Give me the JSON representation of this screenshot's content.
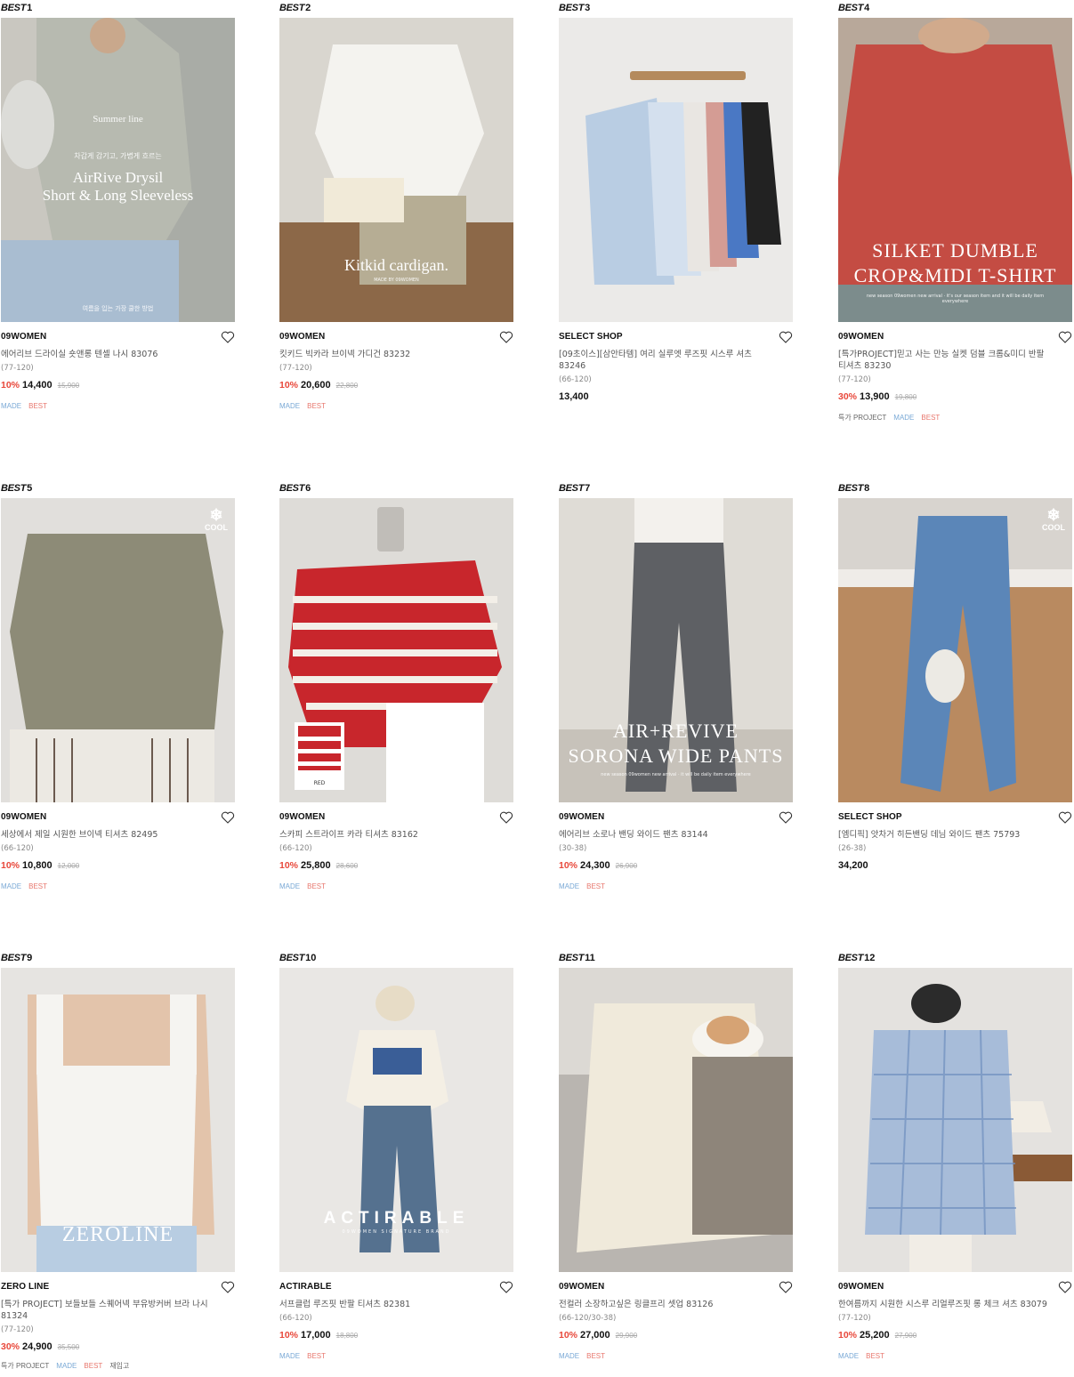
{
  "best_label": "BEST",
  "colors": {
    "discount": "#e8473a",
    "made_tag": "#7aa9d6",
    "best_tag": "#e8776d"
  },
  "products": [
    {
      "rank": "1",
      "brand": "09WOMEN",
      "name": "에어리브 드라이실 숏앤롱 텐셀 나시 83076",
      "size": "(77-120)",
      "discount": "10%",
      "price": "14,400",
      "original": "15,900",
      "tags": [
        "MADE",
        "BEST"
      ],
      "image": {
        "overlay_small": "Summer line",
        "overlay_sub": "차갑게 감기고, 가볍게 흐르는",
        "overlay_title_1": "AirRive Drysil",
        "overlay_title_2": "Short & Long Sleeveless",
        "overlay_caption": "여름을 입는 가장 쿨한 방법"
      }
    },
    {
      "rank": "2",
      "brand": "09WOMEN",
      "name": "킷키드 빅카라 브이넥 가디건 83232",
      "size": "(77-120)",
      "discount": "10%",
      "price": "20,600",
      "original": "22,800",
      "tags": [
        "MADE",
        "BEST"
      ],
      "image": {
        "overlay_title_1": "Kitkid cardigan.",
        "overlay_caption": "MADE BY 09WOMEN"
      }
    },
    {
      "rank": "3",
      "brand": "SELECT SHOP",
      "name": "[09초이스][삼안타템] 여리 실루엣 루즈핏 시스루 셔츠 83246",
      "size": "(66-120)",
      "discount": "",
      "price": "13,400",
      "original": "",
      "tags": [],
      "image": {}
    },
    {
      "rank": "4",
      "brand": "09WOMEN",
      "name": "[특가PROJECT]믿고 사는 만능 실켓 덤블 크롭&미디 반팔 티셔츠 83230",
      "size": "(77-120)",
      "discount": "30%",
      "price": "13,900",
      "original": "19,800",
      "tags": [
        "특가 PROJECT",
        "MADE",
        "BEST"
      ],
      "image": {
        "overlay_title_1": "SILKET DUMBLE",
        "overlay_title_2": "CROP&MIDI T-SHIRT",
        "overlay_caption": "new season 09women new arrival · it's our season item and it will be daily item everywhere"
      }
    },
    {
      "rank": "5",
      "brand": "09WOMEN",
      "name": "세상에서 제일 시원한 브이넥 티셔츠 82495",
      "size": "(66-120)",
      "discount": "10%",
      "price": "10,800",
      "original": "12,000",
      "tags": [
        "MADE",
        "BEST"
      ],
      "image": {
        "badge": "COOL"
      }
    },
    {
      "rank": "6",
      "brand": "09WOMEN",
      "name": "스카피 스트라이프 카라 티셔츠 83162",
      "size": "(66-120)",
      "discount": "10%",
      "price": "25,800",
      "original": "28,600",
      "tags": [
        "MADE",
        "BEST"
      ],
      "image": {
        "swatch_label": "RED"
      }
    },
    {
      "rank": "7",
      "brand": "09WOMEN",
      "name": "에어리브 소로나 밴딩 와이드 팬츠 83144",
      "size": "(30-38)",
      "discount": "10%",
      "price": "24,300",
      "original": "26,900",
      "tags": [
        "MADE",
        "BEST"
      ],
      "image": {
        "overlay_title_1": "AIR+REVIVE",
        "overlay_title_2": "SORONA WIDE PANTS",
        "overlay_caption": "new season 09women new arrival · it will be daily item everywhere"
      }
    },
    {
      "rank": "8",
      "brand": "SELECT SHOP",
      "name": "[엠디픽] 앗차거 히든밴딩 데님 와이드 팬츠 75793",
      "size": "(26-38)",
      "discount": "",
      "price": "34,200",
      "original": "",
      "tags": [],
      "image": {
        "badge": "COOL"
      }
    },
    {
      "rank": "9",
      "brand": "ZERO LINE",
      "name": "[특가 PROJECT] 보들보들 스퀘어넥 부유방커버 브라 나시 81324",
      "size": "(77-120)",
      "discount": "30%",
      "price": "24,900",
      "original": "35,500",
      "tags": [
        "특가 PROJECT",
        "MADE",
        "BEST",
        "재입고"
      ],
      "image": {
        "overlay_title_1": "ZEROLINE"
      }
    },
    {
      "rank": "10",
      "brand": "ACTIRABLE",
      "name": "서프클럽 루즈핏 반팔 티셔츠 82381",
      "size": "(66-120)",
      "discount": "10%",
      "price": "17,000",
      "original": "18,800",
      "tags": [
        "MADE",
        "BEST"
      ],
      "image": {
        "overlay_title_1": "ACTIRABLE",
        "overlay_caption": "09WOMEN SIGNATURE BRAND"
      }
    },
    {
      "rank": "11",
      "brand": "09WOMEN",
      "name": "전컬러 소장하고싶은 링클프리 셋업 83126",
      "size": "(66-120/30-38)",
      "discount": "10%",
      "price": "27,000",
      "original": "29,900",
      "tags": [
        "MADE",
        "BEST"
      ],
      "image": {}
    },
    {
      "rank": "12",
      "brand": "09WOMEN",
      "name": "한여름까지 시원한 시스루 리얼루즈핏 롱 체크 셔츠 83079",
      "size": "(77-120)",
      "discount": "10%",
      "price": "25,200",
      "original": "27,900",
      "tags": [
        "MADE",
        "BEST"
      ],
      "image": {}
    }
  ]
}
